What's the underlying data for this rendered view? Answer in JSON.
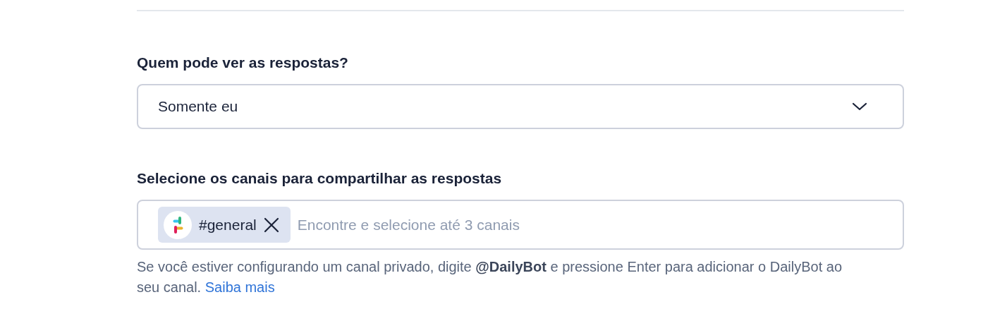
{
  "visibility": {
    "label": "Quem pode ver as respostas?",
    "value": "Somente eu"
  },
  "channels": {
    "label": "Selecione os canais para compartilhar as respostas",
    "tags": [
      {
        "label": "#general"
      }
    ],
    "placeholder": "Encontre e selecione até 3 canais"
  },
  "help": {
    "text": "Se você estiver configurando um canal privado, digite **@DailyBot** e pressione Enter para adicionar o DailyBot ao seu canal.",
    "link": "Saiba mais"
  }
}
